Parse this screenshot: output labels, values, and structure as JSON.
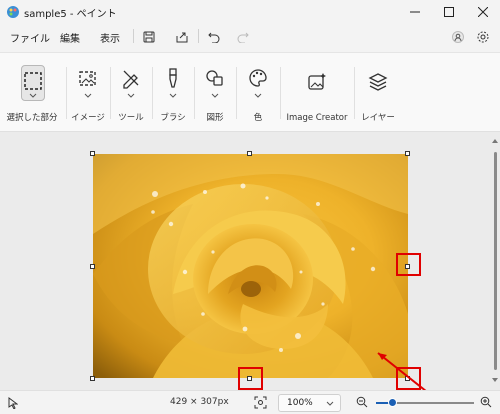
{
  "window": {
    "title": "sample5 - ペイント"
  },
  "menu": {
    "file": "ファイル",
    "edit": "編集",
    "view": "表示"
  },
  "toolbar": {
    "selection": "選択した部分",
    "image": "イメージ",
    "tools": "ツール",
    "brush": "ブラシ",
    "shapes": "図形",
    "colors": "色",
    "image_creator": "Image Creator",
    "layers": "レイヤー"
  },
  "status": {
    "dimensions": "429 × 307px",
    "zoom": "100%"
  },
  "colors": {
    "accent": "#1a5fb4",
    "highlight": "#e00000"
  }
}
